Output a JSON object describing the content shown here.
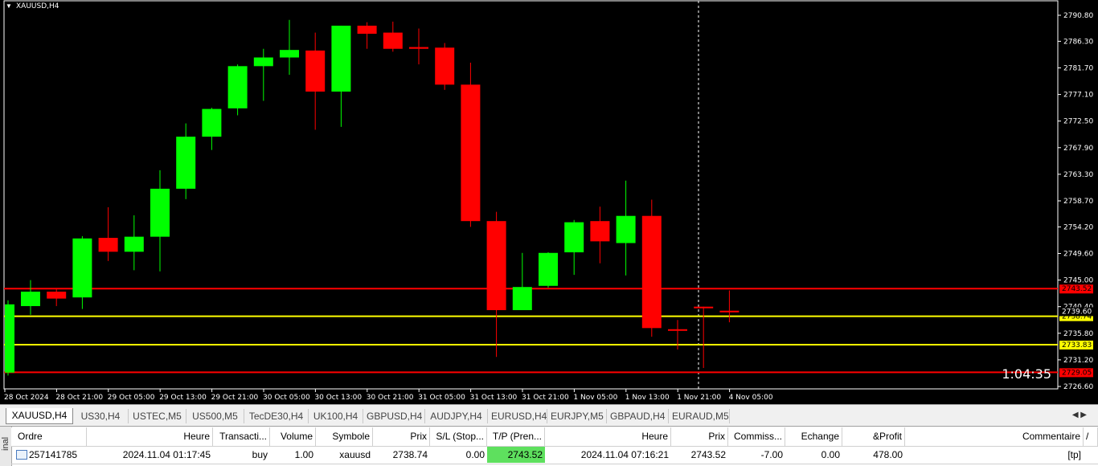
{
  "chart": {
    "title": "XAUUSD,H4",
    "countdown": "1:04:35",
    "price_axis": [
      "2790.80",
      "2786.30",
      "2781.70",
      "2777.10",
      "2772.50",
      "2767.90",
      "2763.30",
      "2758.70",
      "2754.20",
      "2749.60",
      "2745.00",
      "2740.40",
      "2735.80",
      "2731.20",
      "2726.60"
    ],
    "time_axis": [
      "28 Oct 2024",
      "28 Oct 21:00",
      "29 Oct 05:00",
      "29 Oct 13:00",
      "29 Oct 21:00",
      "30 Oct 05:00",
      "30 Oct 13:00",
      "30 Oct 21:00",
      "31 Oct 05:00",
      "31 Oct 13:00",
      "31 Oct 21:00",
      "1 Nov 05:00",
      "1 Nov 13:00",
      "1 Nov 21:00",
      "4 Nov 05:00"
    ],
    "levels": [
      {
        "price": 2743.52,
        "label": "2743.52",
        "color": "#ff0000"
      },
      {
        "price": 2738.74,
        "label": "2738.74",
        "color": "#ffff00"
      },
      {
        "price": 2733.83,
        "label": "2733.83",
        "color": "#ffff00"
      },
      {
        "price": 2729.05,
        "label": "2729.05",
        "color": "#ff0000"
      }
    ],
    "bid_label": "2739.60",
    "colors": {
      "bull": "#00ff00",
      "bear": "#ff0000",
      "background": "#000000"
    },
    "candles": [
      {
        "o": 2729.0,
        "h": 2741.5,
        "l": 2728.5,
        "c": 2740.8
      },
      {
        "o": 2740.5,
        "h": 2745.0,
        "l": 2739.0,
        "c": 2743.0
      },
      {
        "o": 2743.0,
        "h": 2743.5,
        "l": 2740.5,
        "c": 2741.8
      },
      {
        "o": 2742.0,
        "h": 2752.6,
        "l": 2740.0,
        "c": 2752.2
      },
      {
        "o": 2752.3,
        "h": 2757.6,
        "l": 2748.3,
        "c": 2749.9
      },
      {
        "o": 2749.9,
        "h": 2756.2,
        "l": 2746.7,
        "c": 2752.5
      },
      {
        "o": 2752.5,
        "h": 2764.0,
        "l": 2746.5,
        "c": 2760.8
      },
      {
        "o": 2760.8,
        "h": 2772.1,
        "l": 2759.0,
        "c": 2769.8
      },
      {
        "o": 2769.8,
        "h": 2774.8,
        "l": 2767.5,
        "c": 2774.6
      },
      {
        "o": 2774.7,
        "h": 2782.3,
        "l": 2773.5,
        "c": 2782.0
      },
      {
        "o": 2782.0,
        "h": 2785.0,
        "l": 2776.0,
        "c": 2783.5
      },
      {
        "o": 2783.5,
        "h": 2790.0,
        "l": 2780.5,
        "c": 2784.8
      },
      {
        "o": 2784.7,
        "h": 2787.8,
        "l": 2771.0,
        "c": 2777.6
      },
      {
        "o": 2777.6,
        "h": 2789.0,
        "l": 2771.5,
        "c": 2789.0
      },
      {
        "o": 2789.0,
        "h": 2789.6,
        "l": 2785.0,
        "c": 2787.6
      },
      {
        "o": 2787.8,
        "h": 2789.7,
        "l": 2784.5,
        "c": 2785.0
      },
      {
        "o": 2785.3,
        "h": 2788.5,
        "l": 2782.3,
        "c": 2785.0
      },
      {
        "o": 2785.2,
        "h": 2786.0,
        "l": 2777.9,
        "c": 2778.8
      },
      {
        "o": 2778.8,
        "h": 2782.6,
        "l": 2754.2,
        "c": 2755.2
      },
      {
        "o": 2755.2,
        "h": 2756.8,
        "l": 2731.7,
        "c": 2739.8
      },
      {
        "o": 2739.8,
        "h": 2749.7,
        "l": 2739.8,
        "c": 2743.8
      },
      {
        "o": 2744.0,
        "h": 2749.8,
        "l": 2743.7,
        "c": 2749.7
      },
      {
        "o": 2749.8,
        "h": 2755.4,
        "l": 2745.9,
        "c": 2755.0
      },
      {
        "o": 2755.2,
        "h": 2757.7,
        "l": 2747.9,
        "c": 2751.7
      },
      {
        "o": 2751.4,
        "h": 2762.2,
        "l": 2745.8,
        "c": 2756.1
      },
      {
        "o": 2756.1,
        "h": 2758.9,
        "l": 2735.2,
        "c": 2736.7
      },
      {
        "o": 2736.5,
        "h": 2738.1,
        "l": 2733.0,
        "c": 2736.3
      },
      {
        "o": 2740.4,
        "h": 2740.4,
        "l": 2729.8,
        "c": 2740.2
      },
      {
        "o": 2739.7,
        "h": 2743.2,
        "l": 2737.7,
        "c": 2739.6
      }
    ]
  },
  "tabs": [
    "XAUUSD,H4",
    "US30,H4",
    "USTEC,M5",
    "US500,M5",
    "TecDE30,H4",
    "UK100,H4",
    "GBPUSD,H4",
    "AUDJPY,H4",
    "EURUSD,H4",
    "EURJPY,M5",
    "GBPAUD,H4",
    "EURAUD,M5"
  ],
  "terminal": {
    "side_label": "inal",
    "headers": [
      "Ordre",
      "Heure",
      "Transacti...",
      "Volume",
      "Symbole",
      "Prix",
      "S/L (Stop...",
      "T/P (Pren...",
      "Heure",
      "Prix",
      "Commiss...",
      "Echange",
      "&Profit",
      "Commentaire"
    ],
    "sort_arrow": "/",
    "row": [
      "257141785",
      "2024.11.04 01:17:45",
      "buy",
      "1.00",
      "xauusd",
      "2738.74",
      "0.00",
      "2743.52",
      "2024.11.04 07:16:21",
      "2743.52",
      "-7.00",
      "0.00",
      "478.00",
      "[tp]"
    ]
  }
}
